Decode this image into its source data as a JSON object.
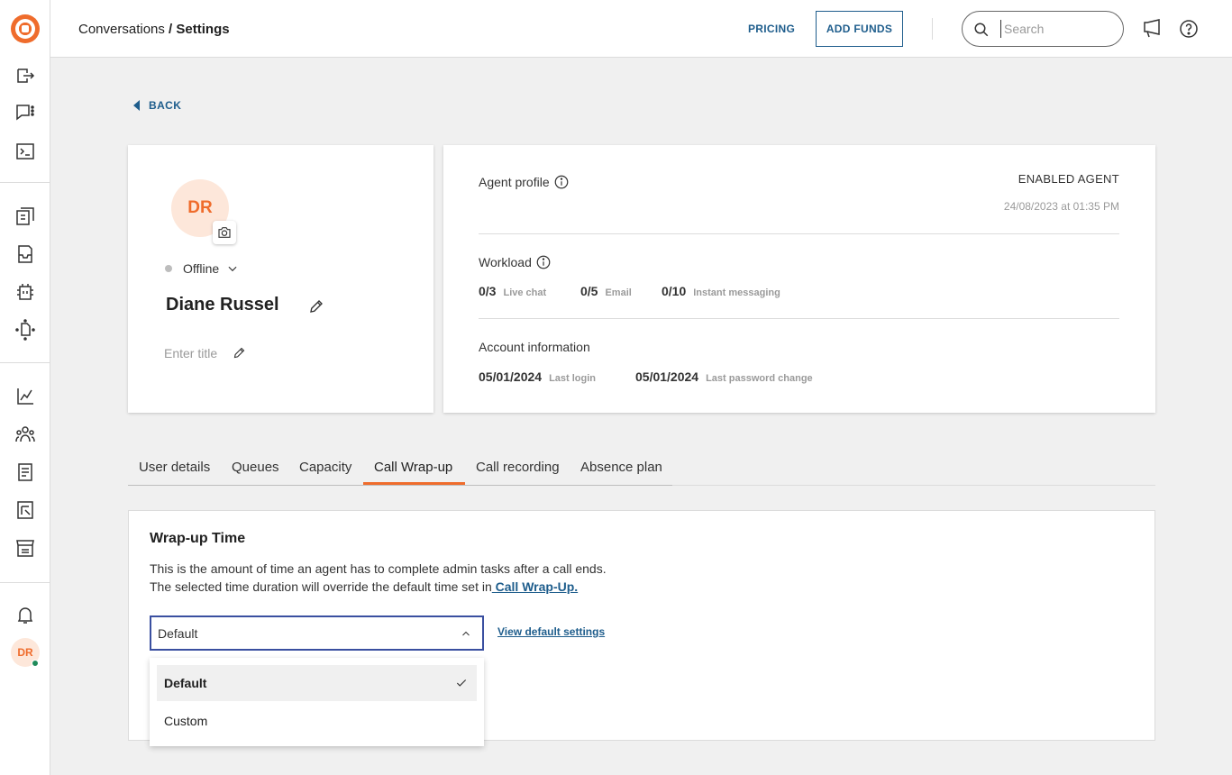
{
  "app": {
    "brand_color": "#ef6c2c",
    "link_color": "#1e5d8c",
    "sidebar": {
      "icons": [
        "outbound-icon",
        "conversations-icon",
        "terminal-icon",
        "knowledge-icon",
        "inbox-icon",
        "bot-icon",
        "flow-icon",
        "analytics-icon",
        "contacts-icon",
        "reports-icon",
        "templates-icon",
        "store-icon",
        "bell-icon"
      ],
      "avatar_initials": "DR"
    }
  },
  "header": {
    "breadcrumb_parent": "Conversations",
    "breadcrumb_sep": " / ",
    "breadcrumb_current": "Settings",
    "pricing_label": "PRICING",
    "add_funds_label": "ADD FUNDS",
    "search_placeholder": "Search"
  },
  "back_label": "BACK",
  "profile": {
    "initials": "DR",
    "status": "Offline",
    "name": "Diane Russel",
    "title_placeholder": "Enter title"
  },
  "info": {
    "agent_profile_label": "Agent profile",
    "agent_state": "ENABLED AGENT",
    "timestamp": "24/08/2023 at 01:35 PM",
    "workload_label": "Workload",
    "workload": [
      {
        "value": "0/3",
        "label": "Live chat"
      },
      {
        "value": "0/5",
        "label": "Email"
      },
      {
        "value": "0/10",
        "label": "Instant messaging"
      }
    ],
    "account_label": "Account information",
    "account": [
      {
        "value": "05/01/2024",
        "label": "Last login"
      },
      {
        "value": "05/01/2024",
        "label": "Last password change"
      }
    ]
  },
  "tabs": [
    "User details",
    "Queues",
    "Capacity",
    "Call Wrap-up",
    "Call recording",
    "Absence plan"
  ],
  "active_tab": "Call Wrap-up",
  "wrapup": {
    "title": "Wrap-up Time",
    "desc_line1": "This is the amount of time an agent has to complete admin tasks after a call ends.",
    "desc_line2": "The selected time duration will override the default time set in",
    "desc_link": " Call Wrap-Up.",
    "select_value": "Default",
    "view_default_label": "View default settings",
    "options": [
      "Default",
      "Custom"
    ],
    "selected_option": "Default"
  }
}
